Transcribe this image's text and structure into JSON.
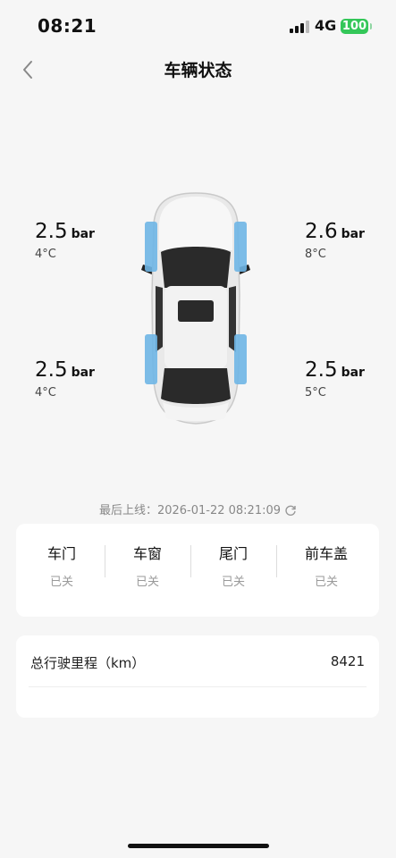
{
  "status_bar": {
    "time": "08:21",
    "network": "4G",
    "battery": "100",
    "signal_icon": "signal-bars-icon",
    "battery_color": "#34c759"
  },
  "header": {
    "title": "车辆状态",
    "back_icon": "chevron-left-icon"
  },
  "tires": {
    "front_left": {
      "pressure": "2.5",
      "unit": "bar",
      "temp": "4°C"
    },
    "front_right": {
      "pressure": "2.6",
      "unit": "bar",
      "temp": "8°C"
    },
    "rear_left": {
      "pressure": "2.5",
      "unit": "bar",
      "temp": "4°C"
    },
    "rear_right": {
      "pressure": "2.5",
      "unit": "bar",
      "temp": "5°C"
    },
    "highlight_color": "#6fb6e6"
  },
  "last_online": {
    "text": "最后上线：2026-01-22 08:21:09",
    "refresh_icon": "refresh-icon"
  },
  "status": {
    "items": [
      {
        "label": "车门",
        "value": "已关"
      },
      {
        "label": "车窗",
        "value": "已关"
      },
      {
        "label": "尾门",
        "value": "已关"
      },
      {
        "label": "前车盖",
        "value": "已关"
      }
    ]
  },
  "mileage": {
    "label": "总行驶里程（km）",
    "value": "8421"
  }
}
